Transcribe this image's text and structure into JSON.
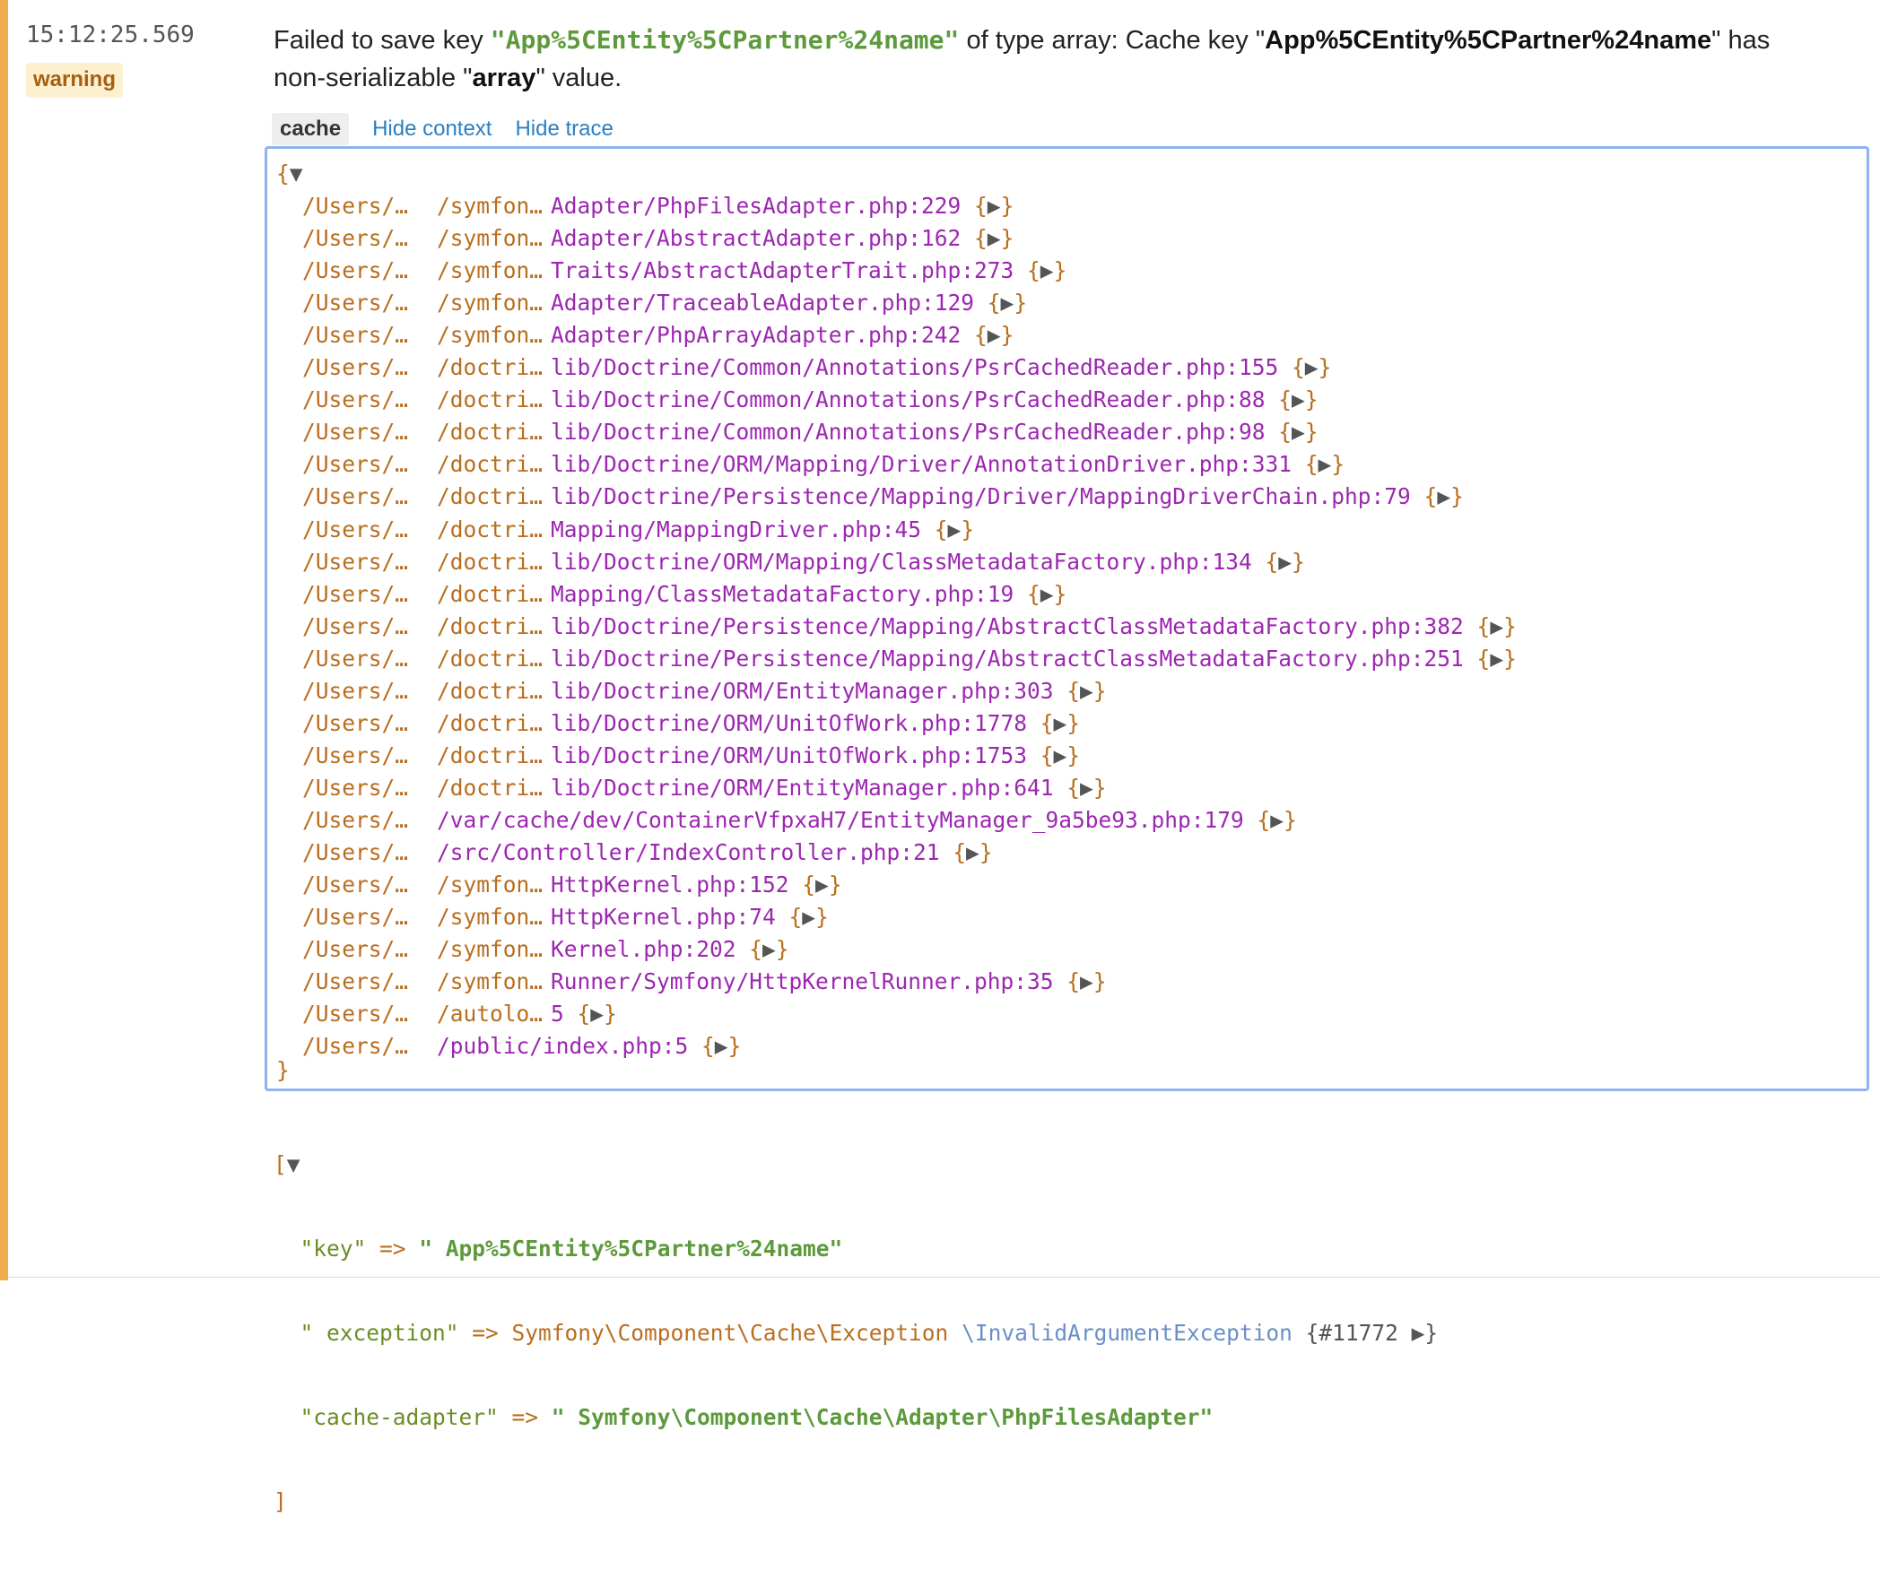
{
  "entry": {
    "time": "15:12:25.569",
    "level": "warning",
    "message": {
      "part1": "Failed to save key ",
      "key_quoted": "\"App%5CEntity%5CPartner%24name\"",
      "part2": " of type array: Cache key \"",
      "key_bold": "App%5CEntity%5CPartner%24name",
      "part3": "\" has non-serializable \"",
      "type_bold": "array",
      "part4": "\" value."
    },
    "colors": {
      "severity": "#f0ad4e",
      "badge_bg": "#fcf0cf",
      "badge_text": "#a85f11",
      "link": "#2c7fc1"
    }
  },
  "tabs": {
    "channel": "cache",
    "hide_context": "Hide context",
    "hide_trace": "Hide trace"
  },
  "trace": {
    "open": "{",
    "open_toggle": "▼",
    "close": "}",
    "frames": [
      {
        "p1": "/Users/…",
        "p2": "/symfon…",
        "file": "Adapter/PhpFilesAdapter.php:229"
      },
      {
        "p1": "/Users/…",
        "p2": "/symfon…",
        "file": "Adapter/AbstractAdapter.php:162"
      },
      {
        "p1": "/Users/…",
        "p2": "/symfon…",
        "file": "Traits/AbstractAdapterTrait.php:273"
      },
      {
        "p1": "/Users/…",
        "p2": "/symfon…",
        "file": "Adapter/TraceableAdapter.php:129"
      },
      {
        "p1": "/Users/…",
        "p2": "/symfon…",
        "file": "Adapter/PhpArrayAdapter.php:242"
      },
      {
        "p1": "/Users/…",
        "p2": "/doctri…",
        "file": "lib/Doctrine/Common/Annotations/PsrCachedReader.php:155"
      },
      {
        "p1": "/Users/…",
        "p2": "/doctri…",
        "file": "lib/Doctrine/Common/Annotations/PsrCachedReader.php:88"
      },
      {
        "p1": "/Users/…",
        "p2": "/doctri…",
        "file": "lib/Doctrine/Common/Annotations/PsrCachedReader.php:98"
      },
      {
        "p1": "/Users/…",
        "p2": "/doctri…",
        "file": "lib/Doctrine/ORM/Mapping/Driver/AnnotationDriver.php:331"
      },
      {
        "p1": "/Users/…",
        "p2": "/doctri…",
        "file": "lib/Doctrine/Persistence/Mapping/Driver/MappingDriverChain.php:79"
      },
      {
        "p1": "/Users/…",
        "p2": "/doctri…",
        "file": "Mapping/MappingDriver.php:45"
      },
      {
        "p1": "/Users/…",
        "p2": "/doctri…",
        "file": "lib/Doctrine/ORM/Mapping/ClassMetadataFactory.php:134"
      },
      {
        "p1": "/Users/…",
        "p2": "/doctri…",
        "file": "Mapping/ClassMetadataFactory.php:19"
      },
      {
        "p1": "/Users/…",
        "p2": "/doctri…",
        "file": "lib/Doctrine/Persistence/Mapping/AbstractClassMetadataFactory.php:382"
      },
      {
        "p1": "/Users/…",
        "p2": "/doctri…",
        "file": "lib/Doctrine/Persistence/Mapping/AbstractClassMetadataFactory.php:251"
      },
      {
        "p1": "/Users/…",
        "p2": "/doctri…",
        "file": "lib/Doctrine/ORM/EntityManager.php:303"
      },
      {
        "p1": "/Users/…",
        "p2": "/doctri…",
        "file": "lib/Doctrine/ORM/UnitOfWork.php:1778"
      },
      {
        "p1": "/Users/…",
        "p2": "/doctri…",
        "file": "lib/Doctrine/ORM/UnitOfWork.php:1753"
      },
      {
        "p1": "/Users/…",
        "p2": "/doctri…",
        "file": "lib/Doctrine/ORM/EntityManager.php:641"
      },
      {
        "p1": "/Users/…",
        "p2": "",
        "file": "/var/cache/dev/ContainerVfpxaH7/EntityManager_9a5be93.php:179"
      },
      {
        "p1": "/Users/…",
        "p2": "",
        "file": "/src/Controller/IndexController.php:21"
      },
      {
        "p1": "/Users/…",
        "p2": "/symfon…",
        "file": "HttpKernel.php:152"
      },
      {
        "p1": "/Users/…",
        "p2": "/symfon…",
        "file": "HttpKernel.php:74"
      },
      {
        "p1": "/Users/…",
        "p2": "/symfon…",
        "file": "Kernel.php:202"
      },
      {
        "p1": "/Users/…",
        "p2": "/symfon…",
        "file": "Runner/Symfony/HttpKernelRunner.php:35"
      },
      {
        "p1": "/Users/…",
        "p2": "/autolo…",
        "file": "5"
      },
      {
        "p1": "/Users/…",
        "p2": "",
        "file": "/public/index.php:5"
      }
    ],
    "expand_token": "{▶}"
  },
  "context": {
    "open": "[",
    "open_toggle": "▼",
    "close": "]",
    "key_label": "\"key\"",
    "arrow": " => ",
    "key_value": "\" App%5CEntity%5CPartner%24name\"",
    "exception_label": "\" exception\"",
    "exception_ns": "Symfony\\Component\\Cache\\Exception",
    "exception_class": "\\InvalidArgumentException",
    "exception_obj": "{#11772 ▶}",
    "adapter_label": "\"cache-adapter\"",
    "adapter_value": "\" Symfony\\Component\\Cache\\Adapter\\PhpFilesAdapter\""
  }
}
